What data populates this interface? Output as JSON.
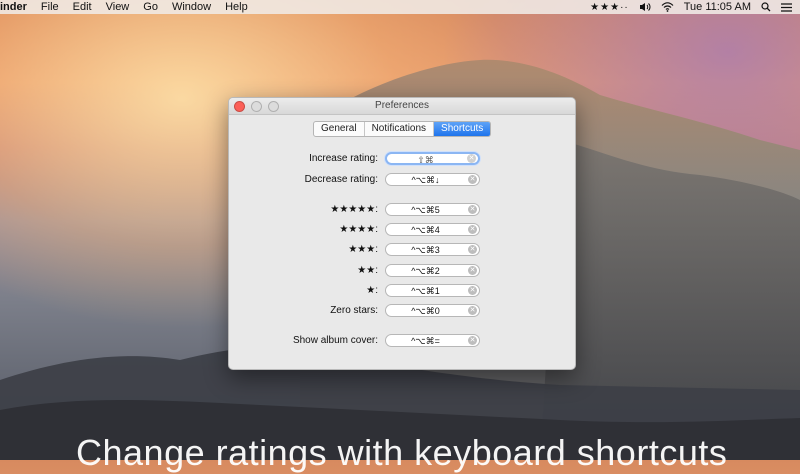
{
  "menubar": {
    "app_name": "inder",
    "menus": [
      "File",
      "Edit",
      "View",
      "Go",
      "Window",
      "Help"
    ],
    "rating_stars": "★★★··",
    "clock": "Tue 11:05 AM"
  },
  "window": {
    "title": "Preferences",
    "tabs": [
      {
        "label": "General",
        "active": false
      },
      {
        "label": "Notifications",
        "active": false
      },
      {
        "label": "Shortcuts",
        "active": true
      }
    ],
    "shortcuts": [
      {
        "label": "Increase rating:",
        "value": "⇧⌘"
      },
      {
        "label": "Decrease rating:",
        "value": "^⌥⌘↓"
      },
      {
        "label": "★★★★★:",
        "value": "^⌥⌘5"
      },
      {
        "label": "★★★★:",
        "value": "^⌥⌘4"
      },
      {
        "label": "★★★:",
        "value": "^⌥⌘3"
      },
      {
        "label": "★★:",
        "value": "^⌥⌘2"
      },
      {
        "label": "★:",
        "value": "^⌥⌘1"
      },
      {
        "label": "Zero stars:",
        "value": "^⌥⌘0"
      },
      {
        "label": "Show album cover:",
        "value": "^⌥⌘="
      }
    ]
  },
  "caption": "Change ratings with keyboard shortcuts",
  "colors": {
    "accent": "#1f74ec",
    "close_button": "#fc5f57",
    "focus_ring": "#8bb6f3"
  }
}
